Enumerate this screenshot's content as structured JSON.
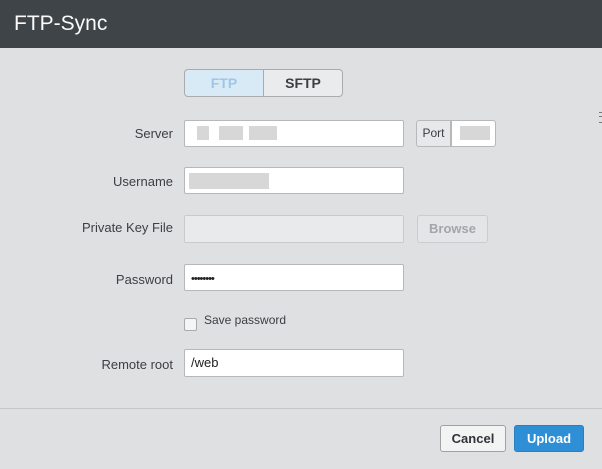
{
  "window": {
    "title": "FTP-Sync"
  },
  "protocol_toggle": {
    "options": [
      "FTP",
      "SFTP"
    ],
    "selected": "FTP"
  },
  "form": {
    "server": {
      "label": "Server",
      "value": ""
    },
    "port": {
      "label": "Port",
      "value": ""
    },
    "username": {
      "label": "Username",
      "value": ""
    },
    "private_key": {
      "label": "Private Key File",
      "value": "",
      "browse_label": "Browse"
    },
    "password": {
      "label": "Password",
      "value": "••••••••"
    },
    "save_password": {
      "label": "Save password",
      "checked": false
    },
    "remote_root": {
      "label": "Remote root",
      "value": "/web"
    }
  },
  "footer": {
    "cancel_label": "Cancel",
    "upload_label": "Upload"
  },
  "colors": {
    "title_bar": "#3e4448",
    "accent": "#2e8fd6",
    "background": "#dfe0e1"
  }
}
